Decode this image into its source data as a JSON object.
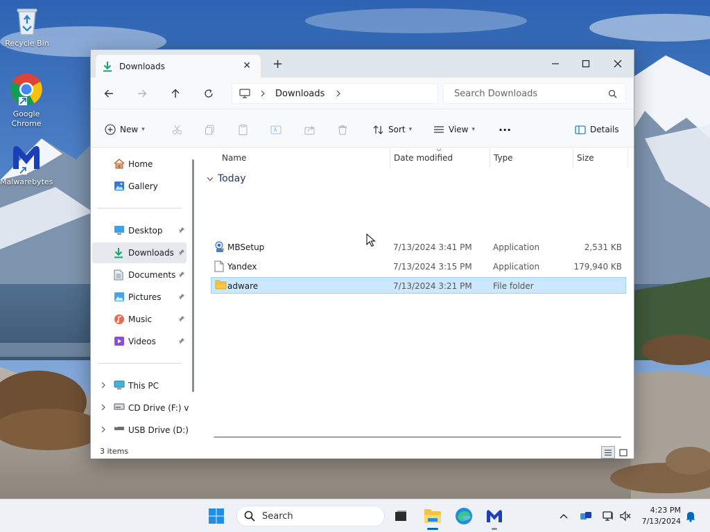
{
  "desktop": {
    "icons": [
      {
        "label": "Recycle Bin"
      },
      {
        "label": "Google Chrome"
      },
      {
        "label": "Malwarebytes"
      }
    ]
  },
  "window": {
    "tab_title": "Downloads",
    "new_tab_glyph": "+",
    "close_tab_glyph": "✕",
    "address": {
      "crumb": "Downloads"
    },
    "search_placeholder": "Search Downloads",
    "toolbar": {
      "new_label": "New",
      "sort_label": "Sort",
      "view_label": "View",
      "more_label": "···",
      "details_label": "Details"
    },
    "sidebar": {
      "items": [
        {
          "label": "Home",
          "icon": "home-icon"
        },
        {
          "label": "Gallery",
          "icon": "gallery-icon"
        },
        {
          "label": "Desktop",
          "icon": "desktop-folder-icon",
          "pinned": true
        },
        {
          "label": "Downloads",
          "icon": "download-icon",
          "pinned": true,
          "selected": true
        },
        {
          "label": "Documents",
          "icon": "documents-icon",
          "pinned": true
        },
        {
          "label": "Pictures",
          "icon": "pictures-icon",
          "pinned": true
        },
        {
          "label": "Music",
          "icon": "music-icon",
          "pinned": true
        },
        {
          "label": "Videos",
          "icon": "videos-icon",
          "pinned": true
        },
        {
          "label": "This PC",
          "icon": "pc-icon"
        },
        {
          "label": "CD Drive (F:) virt",
          "icon": "cd-drive-icon"
        },
        {
          "label": "USB Drive (D:)",
          "icon": "usb-drive-icon"
        }
      ]
    },
    "columns": {
      "name": "Name",
      "date": "Date modified",
      "type": "Type",
      "size": "Size"
    },
    "group": {
      "label": "Today"
    },
    "files": [
      {
        "name": "MBSetup",
        "date": "7/13/2024 3:41 PM",
        "type": "Application",
        "size": "2,531 KB",
        "icon": "installer-icon"
      },
      {
        "name": "Yandex",
        "date": "7/13/2024 3:15 PM",
        "type": "Application",
        "size": "179,940 KB",
        "icon": "file-icon"
      },
      {
        "name": "adware",
        "date": "7/13/2024 3:21 PM",
        "type": "File folder",
        "size": "",
        "icon": "folder-icon",
        "selected": true
      }
    ],
    "status": {
      "count": "3 items"
    }
  },
  "taskbar": {
    "search_label": "Search",
    "clock": {
      "time": "4:23 PM",
      "date": "7/13/2024"
    }
  },
  "colors": {
    "accent": "#0067c0",
    "selection": "#cce8ff",
    "folder": "#f7c744",
    "download_green": "#15a36b"
  }
}
